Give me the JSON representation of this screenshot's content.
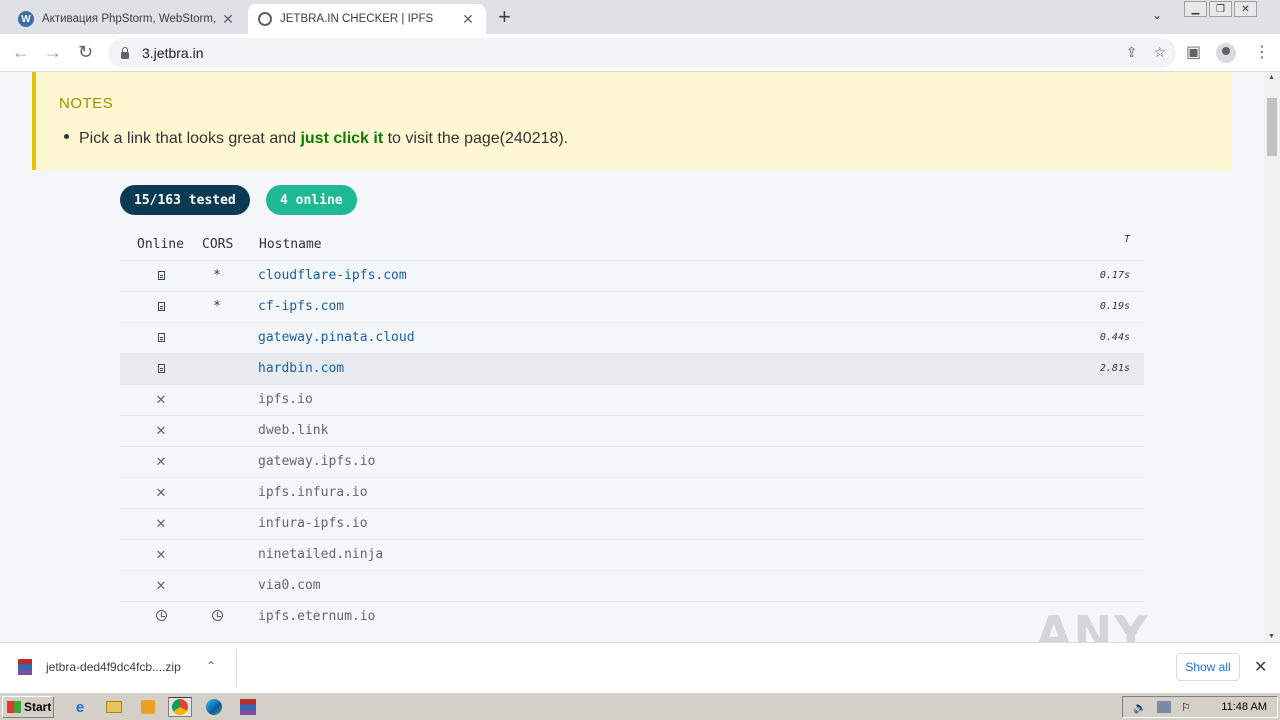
{
  "browser": {
    "tabs": [
      {
        "title": "Активация PhpStorm, WebStorm, IntelliJ IDEA",
        "active": false,
        "icon": "wordpress-icon"
      },
      {
        "title": "JETBRA.IN CHECKER | IPFS",
        "active": true,
        "icon": "globe-icon"
      }
    ],
    "url": "3.jetbra.in"
  },
  "notes": {
    "title": "NOTES",
    "text_before": "Pick a link that looks great and ",
    "highlight": "just click it",
    "text_after": " to visit the page(240218)."
  },
  "stats": {
    "tested": "15/163 tested",
    "online": "4 online"
  },
  "table": {
    "headers": {
      "online": "Online",
      "cors": "CORS",
      "hostname": "Hostname",
      "time": "T"
    },
    "rows": [
      {
        "status": "up",
        "cors": "*",
        "host": "cloudflare-ipfs.com",
        "time": "0.17s"
      },
      {
        "status": "up",
        "cors": "*",
        "host": "cf-ipfs.com",
        "time": "0.19s"
      },
      {
        "status": "up",
        "cors": "",
        "host": "gateway.pinata.cloud",
        "time": "0.44s"
      },
      {
        "status": "up",
        "cors": "",
        "host": "hardbin.com",
        "time": "2.81s"
      },
      {
        "status": "down",
        "cors": "",
        "host": "ipfs.io",
        "time": ""
      },
      {
        "status": "down",
        "cors": "",
        "host": "dweb.link",
        "time": ""
      },
      {
        "status": "down",
        "cors": "",
        "host": "gateway.ipfs.io",
        "time": ""
      },
      {
        "status": "down",
        "cors": "",
        "host": "ipfs.infura.io",
        "time": ""
      },
      {
        "status": "down",
        "cors": "",
        "host": "infura-ipfs.io",
        "time": ""
      },
      {
        "status": "down",
        "cors": "",
        "host": "ninetailed.ninja",
        "time": ""
      },
      {
        "status": "down",
        "cors": "",
        "host": "via0.com",
        "time": ""
      },
      {
        "status": "pending",
        "cors": "pending",
        "host": "ipfs.eternum.io",
        "time": ""
      }
    ]
  },
  "download": {
    "filename": "jetbra-ded4f9dc4fcb....zip",
    "show_all": "Show all"
  },
  "watermark": "ANY RUN",
  "taskbar": {
    "start": "Start",
    "clock": "11:48 AM"
  }
}
